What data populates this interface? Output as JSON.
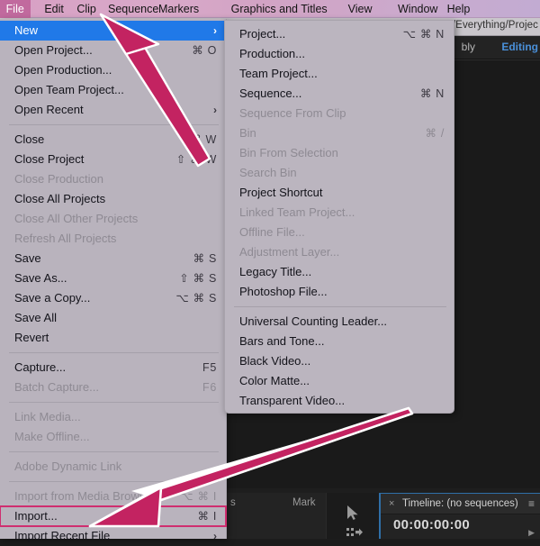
{
  "menubar": {
    "items": [
      {
        "label": "File",
        "active": true
      },
      {
        "label": "Edit",
        "active": false
      },
      {
        "label": "Clip",
        "active": false
      },
      {
        "label": "Sequence",
        "active": false
      },
      {
        "label": "Markers",
        "active": false
      },
      {
        "label": "Graphics and Titles",
        "active": false
      },
      {
        "label": "View",
        "active": false
      },
      {
        "label": "Window",
        "active": false
      },
      {
        "label": "Help",
        "active": false
      }
    ]
  },
  "app": {
    "title_path": "/Everything/Projec",
    "workspace_tabs": [
      {
        "label": "bly",
        "active": false
      },
      {
        "label": "Editing",
        "active": true
      }
    ],
    "source_panel": {
      "left_label": "s",
      "mark_label": "Mark",
      "overflow_icon": "»"
    },
    "tools": {
      "selection_icon": "selection-tool-icon",
      "track_select_icon": "track-select-forward-icon"
    },
    "timeline": {
      "close_icon": "×",
      "tab_label": "Timeline: (no sequences)",
      "menu_icon": "≡",
      "timecode": "00:00:00:00",
      "playhead_icon": "▶"
    },
    "accent_blue": "#4a90d9",
    "focus_border": "#2f6fa8"
  },
  "file_menu": {
    "items": [
      {
        "label": "New",
        "shortcut": "",
        "submenu": true,
        "state": "highlighted"
      },
      {
        "label": "Open Project...",
        "shortcut": "⌘ O",
        "state": "enabled"
      },
      {
        "label": "Open Production...",
        "shortcut": "",
        "state": "enabled"
      },
      {
        "label": "Open Team Project...",
        "shortcut": "",
        "state": "enabled"
      },
      {
        "label": "Open Recent",
        "shortcut": "",
        "submenu": true,
        "state": "enabled"
      },
      {
        "separator": true
      },
      {
        "label": "Close",
        "shortcut": "⌘ W",
        "state": "enabled"
      },
      {
        "label": "Close Project",
        "shortcut": "⇧ ⌘ W",
        "state": "enabled"
      },
      {
        "label": "Close Production",
        "shortcut": "",
        "state": "disabled"
      },
      {
        "label": "Close All Projects",
        "shortcut": "",
        "state": "enabled"
      },
      {
        "label": "Close All Other Projects",
        "shortcut": "",
        "state": "disabled"
      },
      {
        "label": "Refresh All Projects",
        "shortcut": "",
        "state": "disabled"
      },
      {
        "label": "Save",
        "shortcut": "⌘ S",
        "state": "enabled"
      },
      {
        "label": "Save As...",
        "shortcut": "⇧ ⌘ S",
        "state": "enabled"
      },
      {
        "label": "Save a Copy...",
        "shortcut": "⌥ ⌘ S",
        "state": "enabled"
      },
      {
        "label": "Save All",
        "shortcut": "",
        "state": "enabled"
      },
      {
        "label": "Revert",
        "shortcut": "",
        "state": "enabled"
      },
      {
        "separator": true
      },
      {
        "label": "Capture...",
        "shortcut": "F5",
        "state": "enabled"
      },
      {
        "label": "Batch Capture...",
        "shortcut": "F6",
        "state": "disabled"
      },
      {
        "separator": true
      },
      {
        "label": "Link Media...",
        "shortcut": "",
        "state": "disabled"
      },
      {
        "label": "Make Offline...",
        "shortcut": "",
        "state": "disabled"
      },
      {
        "separator": true
      },
      {
        "label": "Adobe Dynamic Link",
        "shortcut": "",
        "submenu": false,
        "state": "disabled"
      },
      {
        "separator": true
      },
      {
        "label": "Import from Media Browser",
        "shortcut": "⌥ ⌘ I",
        "state": "disabled"
      },
      {
        "label": "Import...",
        "shortcut": "⌘ I",
        "state": "enabled",
        "annotated": true
      },
      {
        "label": "Import Recent File",
        "shortcut": "",
        "submenu": true,
        "state": "enabled"
      }
    ]
  },
  "new_submenu": {
    "items": [
      {
        "label": "Project...",
        "shortcut": "⌥ ⌘ N",
        "state": "enabled"
      },
      {
        "label": "Production...",
        "shortcut": "",
        "state": "enabled"
      },
      {
        "label": "Team Project...",
        "shortcut": "",
        "state": "enabled"
      },
      {
        "label": "Sequence...",
        "shortcut": "⌘ N",
        "state": "enabled"
      },
      {
        "label": "Sequence From Clip",
        "shortcut": "",
        "state": "disabled"
      },
      {
        "label": "Bin",
        "shortcut": "⌘ /",
        "state": "disabled"
      },
      {
        "label": "Bin From Selection",
        "shortcut": "",
        "state": "disabled"
      },
      {
        "label": "Search Bin",
        "shortcut": "",
        "state": "disabled"
      },
      {
        "label": "Project Shortcut",
        "shortcut": "",
        "state": "enabled"
      },
      {
        "label": "Linked Team Project...",
        "shortcut": "",
        "state": "disabled"
      },
      {
        "label": "Offline File...",
        "shortcut": "",
        "state": "disabled"
      },
      {
        "label": "Adjustment Layer...",
        "shortcut": "",
        "state": "disabled"
      },
      {
        "label": "Legacy Title...",
        "shortcut": "",
        "state": "enabled"
      },
      {
        "label": "Photoshop File...",
        "shortcut": "",
        "state": "enabled"
      },
      {
        "separator": true
      },
      {
        "label": "Universal Counting Leader...",
        "shortcut": "",
        "state": "enabled"
      },
      {
        "label": "Bars and Tone...",
        "shortcut": "",
        "state": "enabled"
      },
      {
        "label": "Black Video...",
        "shortcut": "",
        "state": "enabled"
      },
      {
        "label": "Color Matte...",
        "shortcut": "",
        "state": "enabled"
      },
      {
        "label": "Transparent Video...",
        "shortcut": "",
        "state": "enabled"
      }
    ]
  },
  "annotations": {
    "color": "#c32361",
    "outline_color": "#ffffff",
    "arrows": [
      {
        "name": "arrow-to-file-menu",
        "target": "File menu title"
      },
      {
        "name": "arrow-to-import-item",
        "target": "Import... menu item"
      }
    ]
  }
}
